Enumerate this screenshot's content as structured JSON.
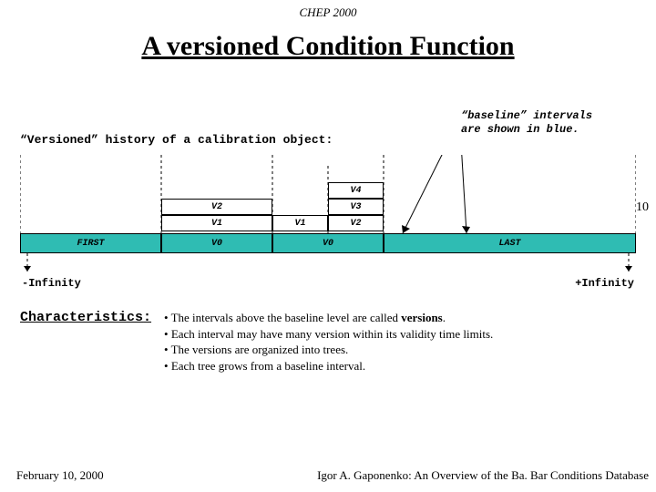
{
  "header": {
    "conference": "CHEP 2000"
  },
  "title": "A versioned Condition Function",
  "subtitle_left": "“Versioned” history of a calibration object:",
  "note_right": {
    "line1": "“baseline” intervals",
    "line2": "are shown in blue."
  },
  "page_number": "10",
  "diagram": {
    "minus_infinity": "-Infinity",
    "plus_infinity": "+Infinity",
    "colors": {
      "baseline": "#2fbcb3"
    },
    "baseline": {
      "first": {
        "label": "FIRST",
        "x_pct": 0,
        "w_pct": 23
      },
      "v0a": {
        "label": "V0",
        "x_pct": 23,
        "w_pct": 18
      },
      "v0b": {
        "label": "V0",
        "x_pct": 41,
        "w_pct": 18
      },
      "last": {
        "label": "LAST",
        "x_pct": 59,
        "w_pct": 41
      }
    },
    "versions": {
      "v1a": {
        "label": "V1",
        "col": "left",
        "row": 1
      },
      "v2a": {
        "label": "V2",
        "col": "left",
        "row": 2
      },
      "v1b": {
        "label": "V1",
        "col": "mid",
        "row": 1
      },
      "v2b": {
        "label": "V2",
        "col": "right",
        "row": 1
      },
      "v3": {
        "label": "V3",
        "col": "right",
        "row": 2
      },
      "v4": {
        "label": "V4",
        "col": "wide",
        "row": 3
      }
    }
  },
  "characteristics": {
    "heading": "Characteristics",
    "bullets": [
      {
        "html": "The intervals above the baseline level are called <b>versions</b>."
      },
      {
        "html": "Each interval may have many version within its validity time limits."
      },
      {
        "html": "The versions are organized into trees."
      },
      {
        "html": "Each tree grows from a baseline interval."
      }
    ]
  },
  "footer": {
    "left": "February 10, 2000",
    "right": "Igor A. Gaponenko: An Overview of the Ba. Bar Conditions Database"
  }
}
